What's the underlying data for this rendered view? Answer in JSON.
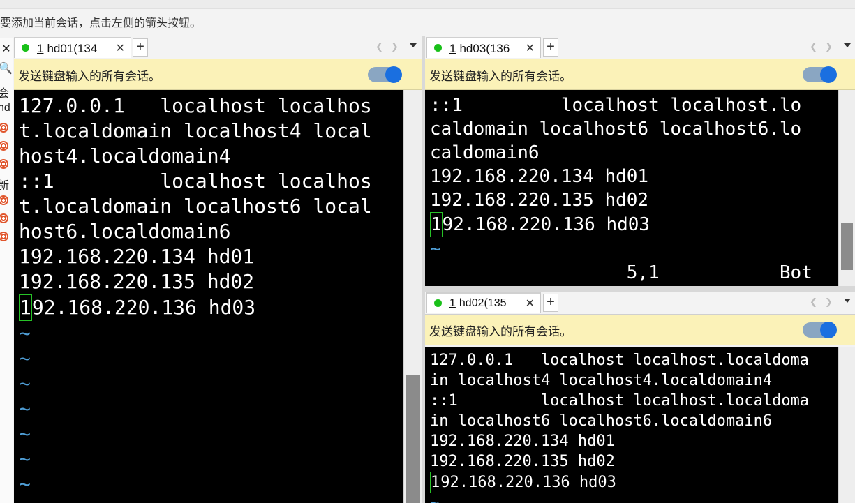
{
  "hint": "要添加当前会话，点击左侧的箭头按钮。",
  "sidebar": {
    "close_glyph": "✕",
    "search_glyph": "🔍",
    "texts": [
      "会",
      "hd",
      "新"
    ]
  },
  "send_all_label": "发送键盘输入的所有会话。",
  "panes": {
    "left": {
      "tab_number": "1",
      "tab_title": "hd01(134",
      "lines": [
        "127.0.0.1   localhost localhos",
        "t.localdomain localhost4 local",
        "host4.localdomain4",
        "::1         localhost localhos",
        "t.localdomain localhost6 local",
        "host6.localdomain6",
        "192.168.220.134 hd01",
        "192.168.220.135 hd02"
      ],
      "cursor_char": "1",
      "cursor_rest": "92.168.220.136 hd03",
      "tildes": [
        "~",
        "~",
        "~",
        "~",
        "~",
        "~",
        "~"
      ]
    },
    "top_right": {
      "tab_number": "1",
      "tab_title": "hd03(136",
      "lines": [
        "::1         localhost localhost.lo",
        "caldomain localhost6 localhost6.lo",
        "caldomain6",
        "192.168.220.134 hd01",
        "192.168.220.135 hd02"
      ],
      "cursor_char": "1",
      "cursor_rest": "92.168.220.136 hd03",
      "tildes": [
        "~"
      ],
      "status_line": "                  5,1           Bot"
    },
    "bottom_right": {
      "tab_number": "1",
      "tab_title": "hd02(135",
      "lines": [
        "127.0.0.1   localhost localhost.localdoma",
        "in localhost4 localhost4.localdomain4",
        "::1         localhost localhost.localdoma",
        "in localhost6 localhost6.localdomain6",
        "192.168.220.134 hd01",
        "192.168.220.135 hd02"
      ],
      "cursor_char": "1",
      "cursor_rest": "92.168.220.136 hd03",
      "tildes": [
        "~"
      ]
    }
  },
  "icons": {
    "tab_close": "✕",
    "new_tab": "+",
    "nav_left": "❮",
    "nav_right": "❯"
  },
  "colors": {
    "status_dot": "#19c019",
    "send_bar": "#fbf2b8",
    "toggle_on": "#1a6fe0",
    "tilde": "#4f9ed6",
    "cursor_border": "#27c227"
  }
}
